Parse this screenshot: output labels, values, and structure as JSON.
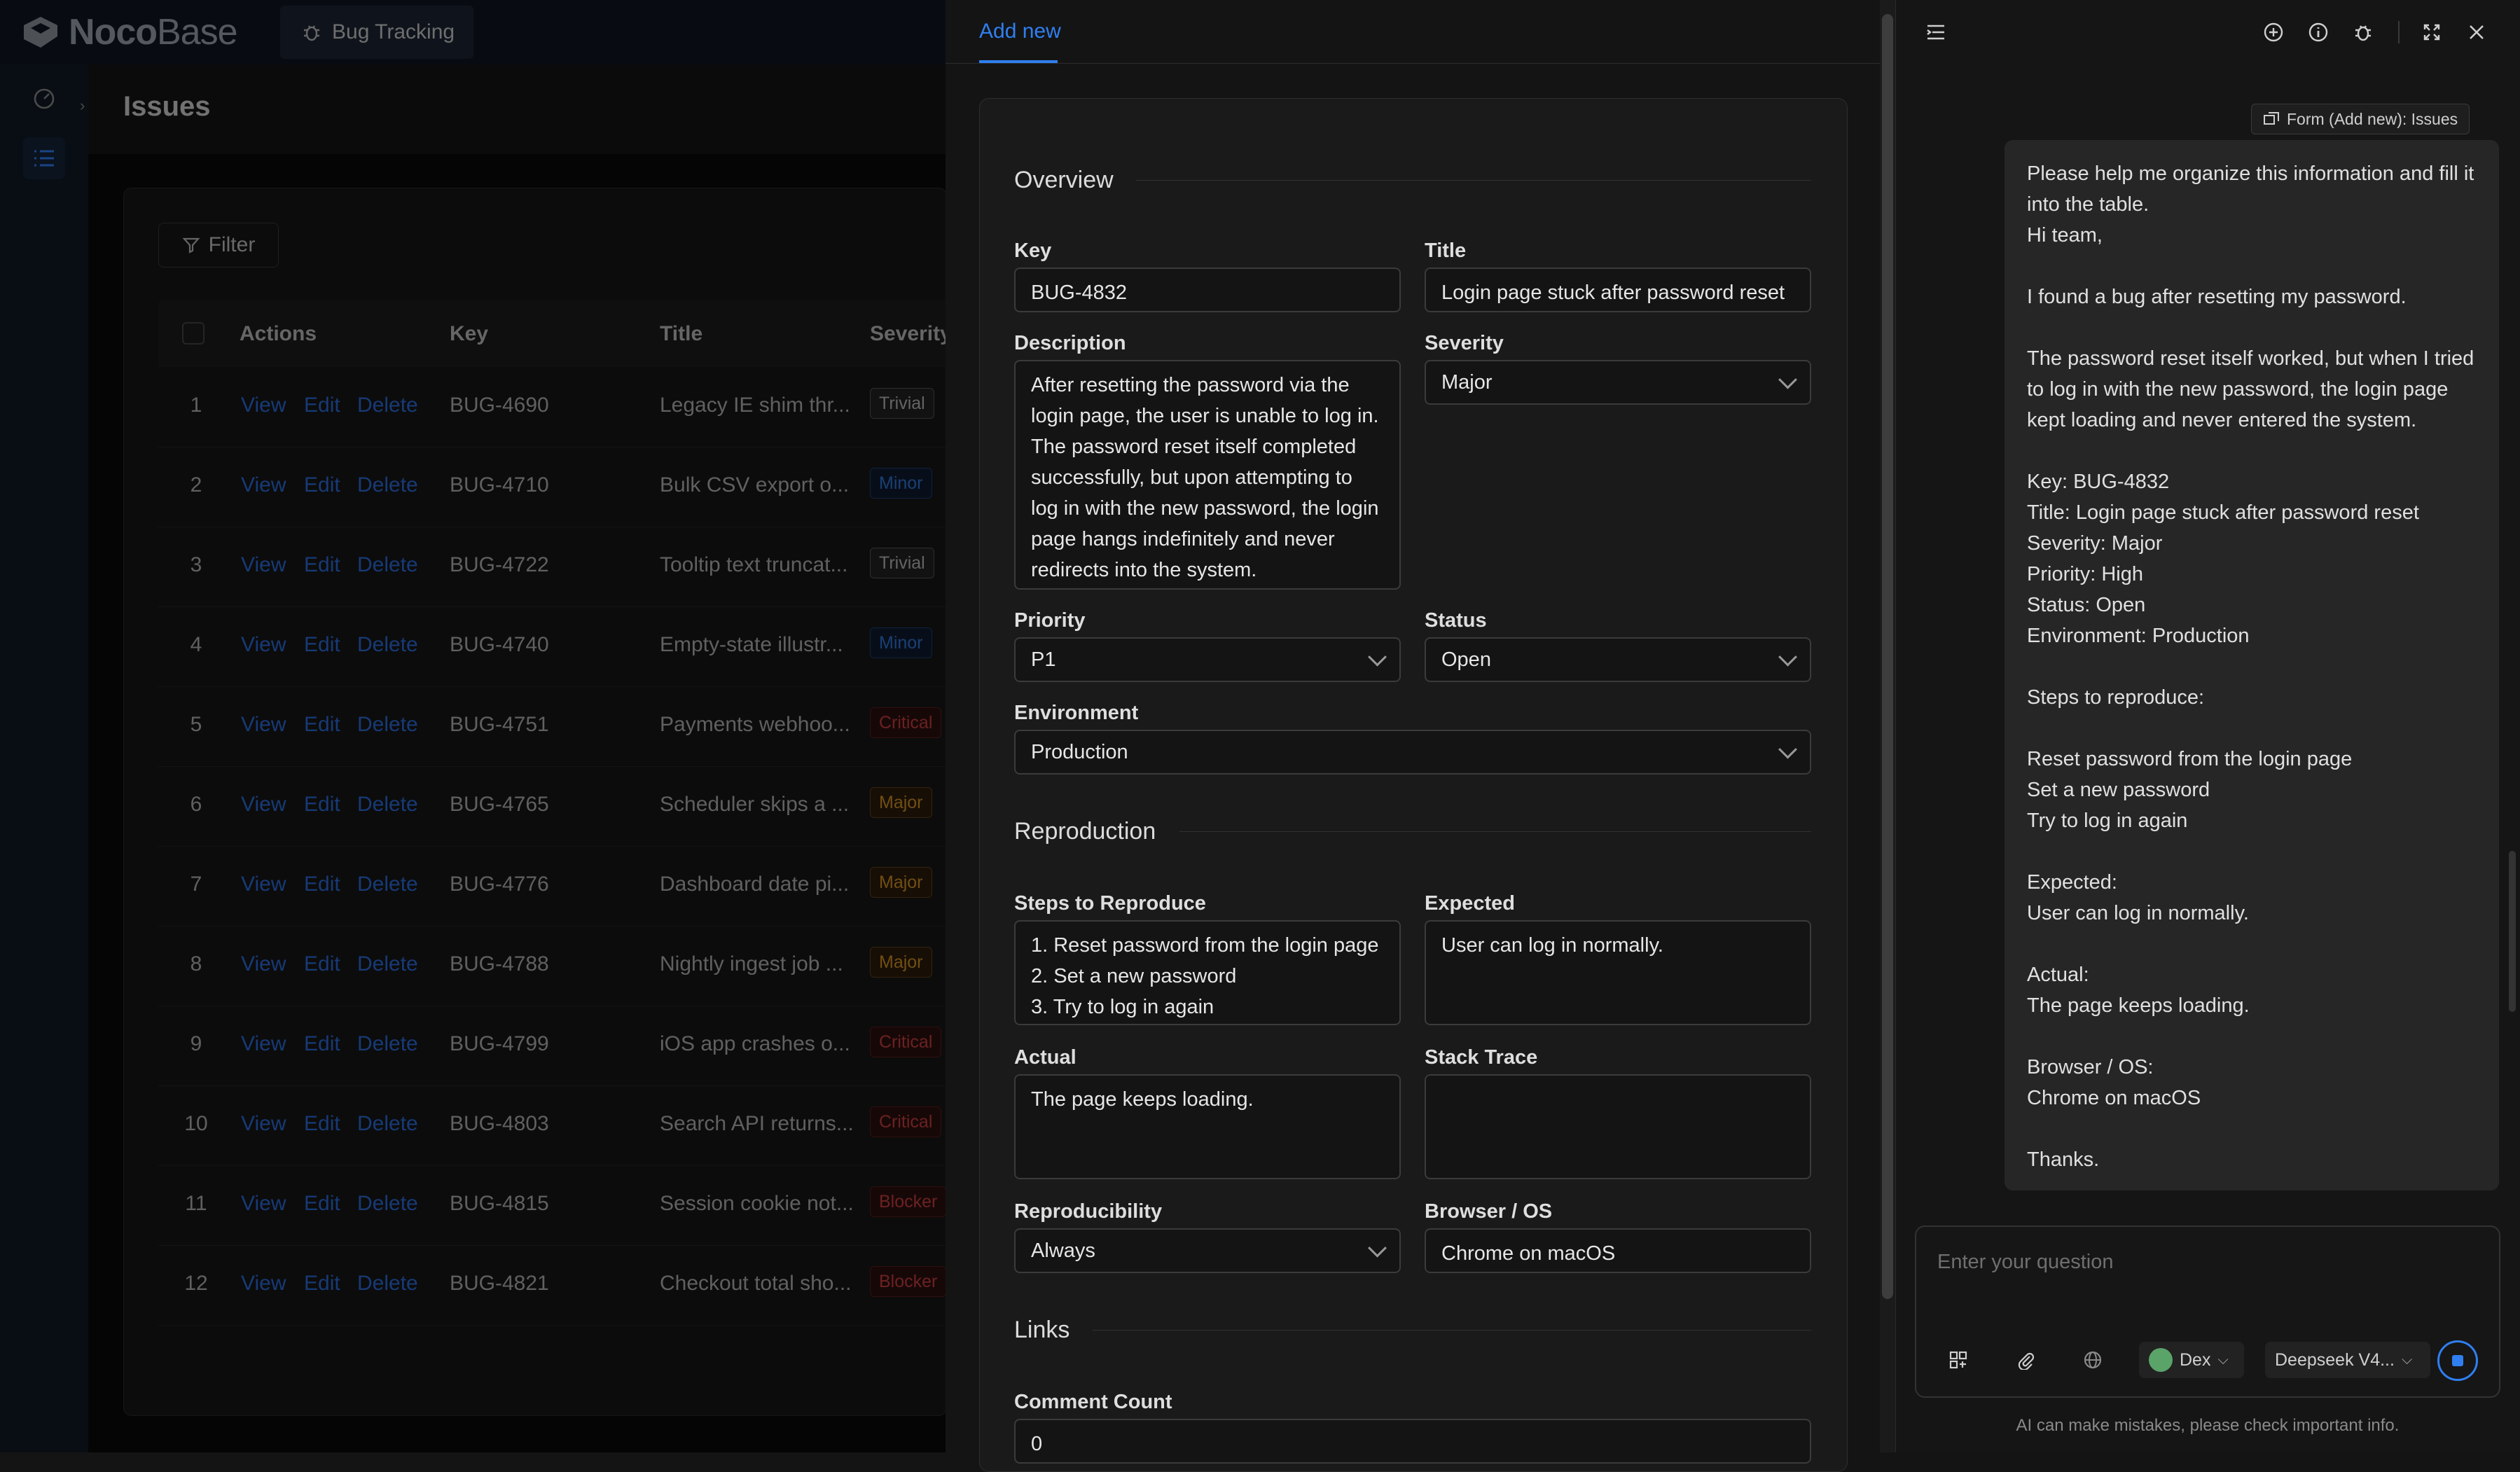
{
  "app": {
    "brand_bold": "Noco",
    "brand_light": "Base",
    "active_tab": "Bug Tracking"
  },
  "page": {
    "title": "Issues"
  },
  "table": {
    "filter_label": "Filter",
    "headers": [
      "Actions",
      "Key",
      "Title",
      "Severity"
    ],
    "actions": {
      "view": "View",
      "edit": "Edit",
      "delete": "Delete"
    },
    "rows": [
      {
        "n": "1",
        "key": "BUG-4690",
        "title": "Legacy IE shim thr...",
        "severity": "Trivial"
      },
      {
        "n": "2",
        "key": "BUG-4710",
        "title": "Bulk CSV export o...",
        "severity": "Minor"
      },
      {
        "n": "3",
        "key": "BUG-4722",
        "title": "Tooltip text truncat...",
        "severity": "Trivial"
      },
      {
        "n": "4",
        "key": "BUG-4740",
        "title": "Empty-state illustr...",
        "severity": "Minor"
      },
      {
        "n": "5",
        "key": "BUG-4751",
        "title": "Payments webhoo...",
        "severity": "Critical"
      },
      {
        "n": "6",
        "key": "BUG-4765",
        "title": "Scheduler skips a ...",
        "severity": "Major"
      },
      {
        "n": "7",
        "key": "BUG-4776",
        "title": "Dashboard date pi...",
        "severity": "Major"
      },
      {
        "n": "8",
        "key": "BUG-4788",
        "title": "Nightly ingest job ...",
        "severity": "Major"
      },
      {
        "n": "9",
        "key": "BUG-4799",
        "title": "iOS app crashes o...",
        "severity": "Critical"
      },
      {
        "n": "10",
        "key": "BUG-4803",
        "title": "Search API returns...",
        "severity": "Critical"
      },
      {
        "n": "11",
        "key": "BUG-4815",
        "title": "Session cookie not...",
        "severity": "Blocker"
      },
      {
        "n": "12",
        "key": "BUG-4821",
        "title": "Checkout total sho...",
        "severity": "Blocker"
      }
    ]
  },
  "drawer": {
    "tab": "Add new",
    "sections": {
      "overview": "Overview",
      "reproduction": "Reproduction",
      "links": "Links"
    },
    "labels": {
      "key": "Key",
      "title": "Title",
      "description": "Description",
      "severity": "Severity",
      "priority": "Priority",
      "status": "Status",
      "environment": "Environment",
      "steps": "Steps to Reproduce",
      "expected": "Expected",
      "actual": "Actual",
      "stack_trace": "Stack Trace",
      "reproducibility": "Reproducibility",
      "browser_os": "Browser / OS",
      "comment_count": "Comment Count"
    },
    "values": {
      "key": "BUG-4832",
      "title": "Login page stuck after password reset",
      "description": "After resetting the password via the login page, the user is unable to log in. The password reset itself completed successfully, but upon attempting to log in with the new password, the login page hangs indefinitely and never redirects into the system.",
      "severity": "Major",
      "priority": "P1",
      "status": "Open",
      "environment": "Production",
      "steps": "1. Reset password from the login page\n2. Set a new password\n3. Try to log in again",
      "expected": "User can log in normally.",
      "actual": "The page keeps loading.",
      "stack_trace": "",
      "reproducibility": "Always",
      "browser_os": "Chrome on macOS",
      "comment_count": "0"
    }
  },
  "ai": {
    "context_chip": "Form (Add new): Issues",
    "message": "Please help me organize this information and fill it into the table.\nHi team,\n\nI found a bug after resetting my password.\n\nThe password reset itself worked, but when I tried to log in with the new password, the login page kept loading and never entered the system.\n\nKey: BUG-4832\nTitle: Login page stuck after password reset\nSeverity: Major\nPriority: High\nStatus: Open\nEnvironment: Production\n\nSteps to reproduce:\n\nReset password from the login page\nSet a new password\nTry to log in again\n\nExpected:\nUser can log in normally.\n\nActual:\nThe page keeps loading.\n\nBrowser / OS:\nChrome on macOS\n\nThanks.",
    "input_placeholder": "Enter your question",
    "assistant_name": "Dex",
    "model_name": "Deepseek V4...",
    "disclaimer": "AI can make mistakes, please check important info."
  }
}
